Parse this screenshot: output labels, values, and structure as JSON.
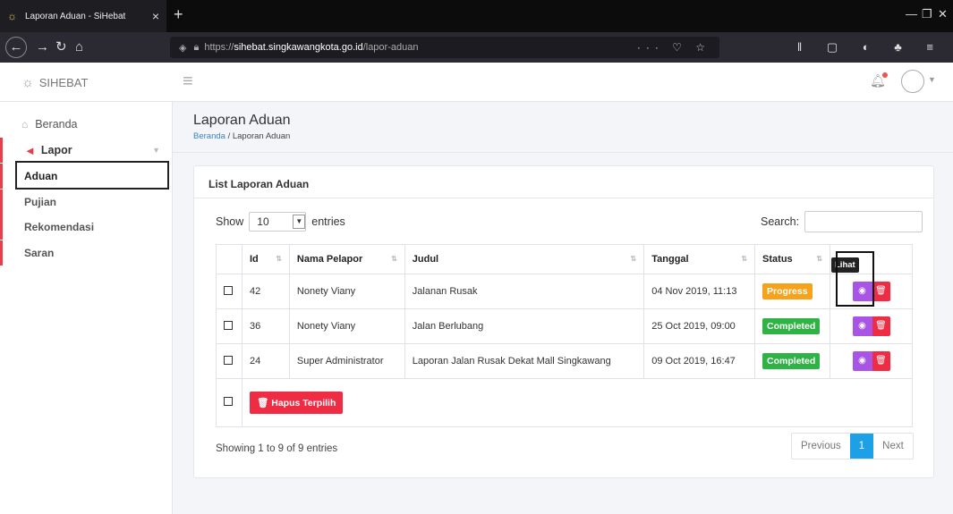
{
  "browser": {
    "tab_title": "Laporan Aduan - SiHebat",
    "url_prefix": "https://",
    "url_host": "sihebat.singkawangkota.go.id",
    "url_path": "/lapor-aduan"
  },
  "header": {
    "brand": "SIHEBAT"
  },
  "sidebar": {
    "home": "Beranda",
    "lapor": "Lapor",
    "items": [
      {
        "label": "Aduan"
      },
      {
        "label": "Pujian"
      },
      {
        "label": "Rekomendasi"
      },
      {
        "label": "Saran"
      }
    ]
  },
  "page": {
    "title": "Laporan Aduan",
    "breadcrumb_home": "Beranda",
    "breadcrumb_sep": "/",
    "breadcrumb_current": "Laporan Aduan"
  },
  "card": {
    "title": "List Laporan Aduan",
    "show_label": "Show",
    "entries_value": "10",
    "entries_label": "entries",
    "search_label": "Search:",
    "columns": {
      "id": "Id",
      "nama": "Nama Pelapor",
      "judul": "Judul",
      "tanggal": "Tanggal",
      "status": "Status"
    },
    "rows": [
      {
        "id": "42",
        "nama": "Nonety Viany",
        "judul": "Jalanan Rusak",
        "tanggal": "04 Nov 2019, 11:13",
        "status": "Progress"
      },
      {
        "id": "36",
        "nama": "Nonety Viany",
        "judul": "Jalan Berlubang",
        "tanggal": "25 Oct 2019, 09:00",
        "status": "Completed"
      },
      {
        "id": "24",
        "nama": "Super Administrator",
        "judul": "Laporan Jalan Rusak Dekat Mall Singkawang",
        "tanggal": "09 Oct 2019, 16:47",
        "status": "Completed"
      }
    ],
    "delete_selected": "Hapus Terpilih",
    "tooltip": "Lihat",
    "info": "Showing 1 to 9 of 9 entries",
    "pager": {
      "prev": "Previous",
      "current": "1",
      "next": "Next"
    }
  },
  "colors": {
    "accent": "#e83e4a",
    "progress": "#f7a21b",
    "completed": "#2fb344",
    "view": "#a855e6",
    "delete": "#ee2d45",
    "pager_active": "#1ea0e6"
  },
  "icons": [
    "lightbulb-icon",
    "menu-icon",
    "bell-icon",
    "user-avatar-icon",
    "home-icon",
    "megaphone-icon",
    "eye-icon",
    "trash-icon"
  ]
}
